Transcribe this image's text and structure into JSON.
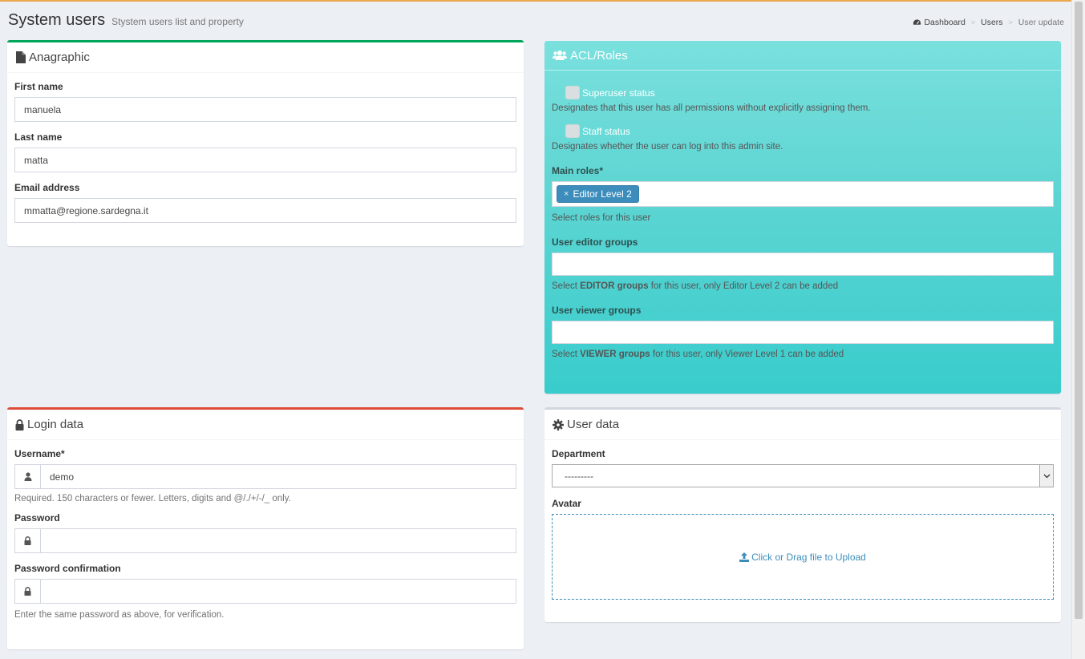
{
  "header": {
    "title": "System users",
    "subtitle": "Stystem users list and property"
  },
  "breadcrumb": {
    "items": [
      "Dashboard",
      "Users",
      "User update"
    ],
    "separator": ">"
  },
  "anagraphic": {
    "title": "Anagraphic",
    "first_name_label": "First name",
    "first_name_value": "manuela",
    "last_name_label": "Last name",
    "last_name_value": "matta",
    "email_label": "Email address",
    "email_value": "mmatta@regione.sardegna.it"
  },
  "acl": {
    "title": "ACL/Roles",
    "superuser_label": "Superuser status",
    "superuser_help": "Designates that this user has all permissions without explicitly assigning them.",
    "staff_label": "Staff status",
    "staff_help": "Designates whether the user can log into this admin site.",
    "main_roles_label": "Main roles*",
    "main_roles_tag_remove": "×",
    "main_roles_tag": "Editor Level 2",
    "main_roles_help": "Select roles for this user",
    "editor_groups_label": "User editor groups",
    "editor_help_pre": "Select ",
    "editor_help_bold": "EDITOR groups",
    "editor_help_post": " for this user, only Editor Level 2 can be added",
    "viewer_groups_label": "User viewer groups",
    "viewer_help_pre": "Select ",
    "viewer_help_bold": "VIEWER groups",
    "viewer_help_post": " for this user, only Viewer Level 1 can be added"
  },
  "login": {
    "title": "Login data",
    "username_label": "Username*",
    "username_value": "demo",
    "username_help": "Required. 150 characters or fewer. Letters, digits and @/./+/-/_ only.",
    "password_label": "Password",
    "password_value": "",
    "password_confirm_label": "Password confirmation",
    "password_confirm_value": "",
    "password_confirm_help": "Enter the same password as above, for verification."
  },
  "userdata": {
    "title": "User data",
    "department_label": "Department",
    "department_value": "---------",
    "avatar_label": "Avatar",
    "upload_text": "Click or Drag file to Upload"
  },
  "colors": {
    "accent_blue": "#3c8dbc",
    "acl_teal": "#39cccc",
    "green_top": "#00a65a",
    "red_top": "#dd4b39"
  }
}
